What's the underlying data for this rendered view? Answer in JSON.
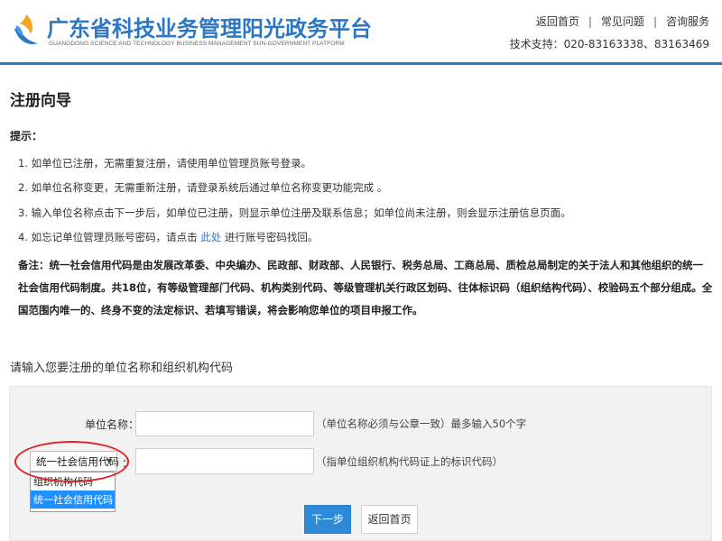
{
  "header": {
    "title": "广东省科技业务管理阳光政务平台",
    "subtitle": "GUANGDONG SCIENCE AND TECHNOLOGY BUSINESS MANAGEMENT SUN-GOVERNMENT PLATFORM",
    "links": [
      "返回首页",
      "常见问题",
      "咨询服务"
    ],
    "separator": "|",
    "support": "技术支持：020-83163338、83163469"
  },
  "page": {
    "title": "注册向导",
    "hint_title": "提示：",
    "hints": [
      "1. 如单位已注册，无需重复注册，请使用单位管理员账号登录。",
      "2. 如单位名称变更，无需重新注册，请登录系统后通过单位名称变更功能完成 。",
      "3. 输入单位名称点击下一步后，如单位已注册，则显示单位注册及联系信息；如单位尚未注册，则会显示注册信息页面。"
    ],
    "hint4_prefix": "4. 如忘记单位管理员账号密码，请点击 ",
    "hint4_link": "此处",
    "hint4_suffix": " 进行账号密码找回。",
    "note": "备注：统一社会信用代码是由发展改革委、中央编办、民政部、财政部、人民银行、税务总局、工商总局、质检总局制定的关于法人和其他组织的统一社会信用代码制度。共18位，有等级管理部门代码、机构类别代码、等级管理机关行政区划码、往体标识码（组织结构代码）、校验码五个部分组成。全国范围内唯一的、终身不变的法定标识、若填写错误，将会影响您单位的项目申报工作。"
  },
  "form": {
    "section_title": "请输入您要注册的单位名称和组织机构代码",
    "unit_name_label": "单位名称：",
    "unit_name_value": "",
    "unit_name_hint": "（单位名称必须与公章一致）最多输入50个字",
    "code_type_selected": "统一社会信用代码",
    "code_type_options": [
      "组织机构代码",
      "统一社会信用代码"
    ],
    "code_colon": "：",
    "code_value": "",
    "code_hint": "（指单位组织机构代码证上的标识代码）",
    "next_button": "下一步",
    "back_button": "返回首页"
  },
  "colors": {
    "brand": "#2b77c4",
    "primary_button": "#2c8ad8",
    "highlight_circle": "#e0252a",
    "selected_option": "#1e90ff"
  }
}
